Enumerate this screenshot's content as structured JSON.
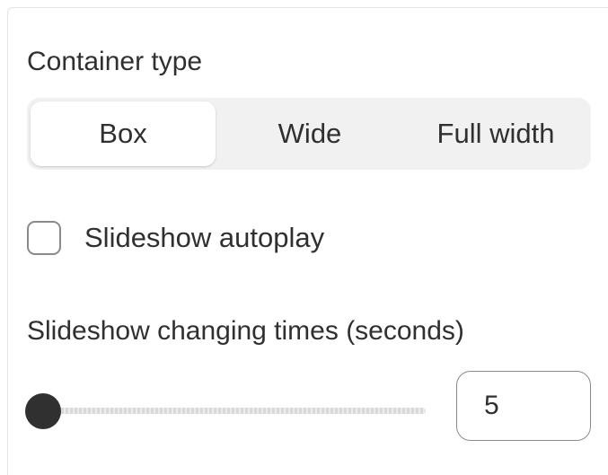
{
  "container_type": {
    "label": "Container type",
    "options": [
      "Box",
      "Wide",
      "Full width"
    ],
    "selected": "Box"
  },
  "autoplay": {
    "label": "Slideshow autoplay",
    "checked": false
  },
  "changing_time": {
    "label": "Slideshow changing times (seconds)",
    "value": "5",
    "slider_fraction": 0
  }
}
